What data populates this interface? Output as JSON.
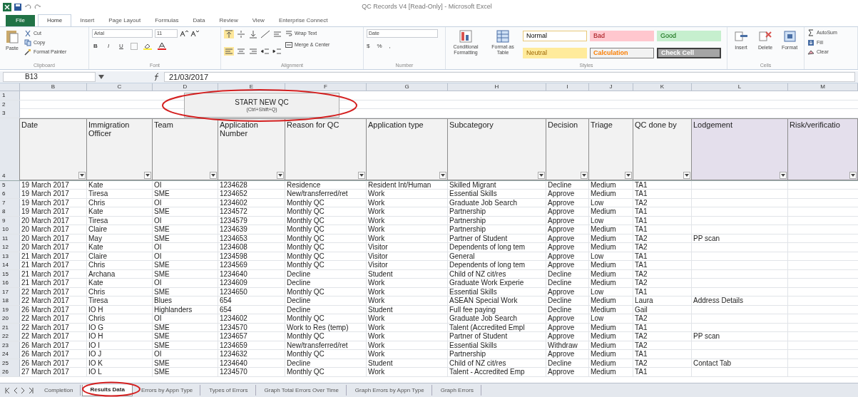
{
  "window": {
    "title": "QC Records V4 [Read-Only] - Microsoft Excel"
  },
  "ribbon_tabs": [
    {
      "label": "File",
      "kind": "file",
      "selected": false
    },
    {
      "label": "Home",
      "kind": "tab",
      "selected": true
    },
    {
      "label": "Insert",
      "kind": "tab",
      "selected": false
    },
    {
      "label": "Page Layout",
      "kind": "tab",
      "selected": false
    },
    {
      "label": "Formulas",
      "kind": "tab",
      "selected": false
    },
    {
      "label": "Data",
      "kind": "tab",
      "selected": false
    },
    {
      "label": "Review",
      "kind": "tab",
      "selected": false
    },
    {
      "label": "View",
      "kind": "tab",
      "selected": false
    },
    {
      "label": "Enterprise Connect",
      "kind": "tab",
      "selected": false
    }
  ],
  "ribbon": {
    "clipboard": {
      "label": "Clipboard",
      "paste": "Paste",
      "items": [
        "Cut",
        "Copy",
        "Format Painter"
      ]
    },
    "font": {
      "label": "Font",
      "name": "Arial",
      "size": "11",
      "styles": [
        "B",
        "I",
        "U"
      ]
    },
    "alignment": {
      "label": "Alignment",
      "wrap": "Wrap Text",
      "merge": "Merge & Center"
    },
    "number": {
      "label": "Number",
      "format": "Date",
      "symbols": [
        "$",
        "%",
        ","
      ]
    },
    "styles": {
      "label": "Styles",
      "buttons": [
        "Conditional Formatting",
        "Format as Table"
      ],
      "cell_styles": [
        {
          "label": "Normal",
          "kind": "normal"
        },
        {
          "label": "Bad",
          "kind": "bad"
        },
        {
          "label": "Good",
          "kind": "good"
        },
        {
          "label": "Neutral",
          "kind": "neutral"
        },
        {
          "label": "Calculation",
          "kind": "calculation"
        },
        {
          "label": "Check Cell",
          "kind": "check"
        }
      ]
    },
    "cells": {
      "label": "Cells",
      "buttons": [
        "Insert",
        "Delete",
        "Format"
      ]
    },
    "editing": {
      "items": [
        "AutoSum",
        "Fill",
        "Clear"
      ]
    }
  },
  "formula_bar": {
    "name_box": "B13",
    "value": "21/03/2017"
  },
  "sheet": {
    "columns": [
      "B",
      "C",
      "D",
      "E",
      "F",
      "G",
      "H",
      "I",
      "J",
      "K",
      "L",
      "M"
    ],
    "top_rows": [
      "1",
      "2",
      "3"
    ],
    "start_button": {
      "label": "START NEW QC",
      "shortcut": "(Ctrl+Shift+Q)"
    },
    "header_row": "4",
    "headers": [
      {
        "label": "Date",
        "purple": false
      },
      {
        "label": "Immigration Officer",
        "purple": false
      },
      {
        "label": "Team",
        "purple": false
      },
      {
        "label": "Application Number",
        "purple": false
      },
      {
        "label": "Reason for QC",
        "purple": false
      },
      {
        "label": "Application type",
        "purple": false
      },
      {
        "label": "Subcategory",
        "purple": false
      },
      {
        "label": "Decision",
        "purple": false
      },
      {
        "label": "Triage",
        "purple": false
      },
      {
        "label": "QC done by",
        "purple": false
      },
      {
        "label": "Lodgement",
        "purple": true
      },
      {
        "label": "Risk/verificatio",
        "purple": true
      }
    ],
    "rows": [
      {
        "number": "5",
        "cells": [
          "19 March 2017",
          "Kate",
          "OI",
          "1234628",
          "Residence",
          "Resident Int/Human",
          "Skilled Migrant",
          "Decline",
          "Medium",
          "TA1"
        ]
      },
      {
        "number": "6",
        "cells": [
          "19 March 2017",
          "Tiresa",
          "SME",
          "1234652",
          "New/transferred/ret",
          "Work",
          "Essential Skills",
          "Approve",
          "Medium",
          "TA1"
        ]
      },
      {
        "number": "7",
        "cells": [
          "19 March 2017",
          "Chris",
          "OI",
          "1234602",
          "Monthly QC",
          "Work",
          "Graduate Job Search",
          "Approve",
          "Low",
          "TA2"
        ]
      },
      {
        "number": "8",
        "cells": [
          "19 March 2017",
          "Kate",
          "SME",
          "1234572",
          "Monthly QC",
          "Work",
          "Partnership",
          "Approve",
          "Medium",
          "TA1"
        ]
      },
      {
        "number": "9",
        "cells": [
          "20 March 2017",
          "Tiresa",
          "OI",
          "1234579",
          "Monthly QC",
          "Work",
          "Partnership",
          "Approve",
          "Low",
          "TA1"
        ]
      },
      {
        "number": "10",
        "cells": [
          "20 March 2017",
          "Claire",
          "SME",
          "1234639",
          "Monthly QC",
          "Work",
          "Partnership",
          "Approve",
          "Medium",
          "TA1"
        ]
      },
      {
        "number": "11",
        "cells": [
          "20 March 2017",
          "May",
          "SME",
          "1234653",
          "Monthly QC",
          "Work",
          "Partner of Student",
          "Approve",
          "Medium",
          "TA2"
        ],
        "lodgement": "PP scan"
      },
      {
        "number": "12",
        "cells": [
          "20 March 2017",
          "Kate",
          "OI",
          "1234608",
          "Monthly QC",
          "Visitor",
          "Dependents of long tem",
          "Approve",
          "Medium",
          "TA2"
        ]
      },
      {
        "number": "13",
        "cells": [
          "21 March 2017",
          "Claire",
          "OI",
          "1234598",
          "Monthly QC",
          "Visitor",
          "General",
          "Approve",
          "Low",
          "TA1"
        ]
      },
      {
        "number": "14",
        "cells": [
          "21 March 2017",
          "Chris",
          "SME",
          "1234569",
          "Monthly QC",
          "Visitor",
          "Dependents of long tem",
          "Approve",
          "Medium",
          "TA1"
        ]
      },
      {
        "number": "15",
        "cells": [
          "21 March 2017",
          "Archana",
          "SME",
          "1234640",
          "Decline",
          "Student",
          "Child of NZ cit/res",
          "Decline",
          "Medium",
          "TA2"
        ]
      },
      {
        "number": "16",
        "cells": [
          "21 March 2017",
          "Kate",
          "OI",
          "1234609",
          "Decline",
          "Work",
          "Graduate Work Experie",
          "Decline",
          "Medium",
          "TA2"
        ]
      },
      {
        "number": "17",
        "cells": [
          "22 March 2017",
          "Chris",
          "SME",
          "1234650",
          "Monthly QC",
          "Work",
          "Essential Skills",
          "Approve",
          "Low",
          "TA1"
        ]
      },
      {
        "number": "18",
        "cells": [
          "22 March 2017",
          "Tiresa",
          "Blues",
          "654",
          "Decline",
          "Work",
          "ASEAN Special Work",
          "Decline",
          "Medium",
          "Laura"
        ],
        "lodgement": "Address Details"
      },
      {
        "number": "19",
        "cells": [
          "26 March 2017",
          "IO H",
          "Highlanders",
          "654",
          "Decline",
          "Student",
          "Full fee paying",
          "Decline",
          "Medium",
          "Gail"
        ]
      },
      {
        "number": "20",
        "cells": [
          "22 March 2017",
          "Chris",
          "OI",
          "1234602",
          "Monthly QC",
          "Work",
          "Graduate Job Search",
          "Approve",
          "Low",
          "TA2"
        ]
      },
      {
        "number": "21",
        "cells": [
          "22 March 2017",
          "IO G",
          "SME",
          "1234570",
          "Work to Res (temp)",
          "Work",
          "Talent (Accredited Empl",
          "Approve",
          "Medium",
          "TA1"
        ]
      },
      {
        "number": "22",
        "cells": [
          "22 March 2017",
          "IO H",
          "SME",
          "1234657",
          "Monthly QC",
          "Work",
          "Partner of Student",
          "Approve",
          "Medium",
          "TA2"
        ],
        "lodgement": "PP scan"
      },
      {
        "number": "23",
        "cells": [
          "26 March 2017",
          "IO I",
          "SME",
          "1234659",
          "New/transferred/ret",
          "Work",
          "Essential Skills",
          "Withdraw",
          "Medium",
          "TA2"
        ]
      },
      {
        "number": "24",
        "cells": [
          "26 March 2017",
          "IO J",
          "OI",
          "1234632",
          "Monthly QC",
          "Work",
          "Partnership",
          "Approve",
          "Medium",
          "TA1"
        ]
      },
      {
        "number": "25",
        "cells": [
          "26 March 2017",
          "IO K",
          "SME",
          "1234640",
          "Decline",
          "Student",
          "Child of NZ cit/res",
          "Decline",
          "Medium",
          "TA2"
        ],
        "lodgement": "Contact Tab"
      },
      {
        "number": "26",
        "cells": [
          "27 March 2017",
          "IO L",
          "SME",
          "1234570",
          "Monthly QC",
          "Work",
          "Talent - Accredited Emp",
          "Approve",
          "Medium",
          "TA1"
        ]
      }
    ]
  },
  "sheet_tabs": [
    {
      "label": "Completion",
      "selected": false
    },
    {
      "label": "Results Data",
      "selected": true
    },
    {
      "label": "Errors by Appn Type",
      "selected": false
    },
    {
      "label": "Types of Errors",
      "selected": false
    },
    {
      "label": "Graph Total Errors Over Time",
      "selected": false
    },
    {
      "label": "Graph Errors by Appn Type",
      "selected": false
    },
    {
      "label": "Graph Errors",
      "selected": false
    }
  ]
}
